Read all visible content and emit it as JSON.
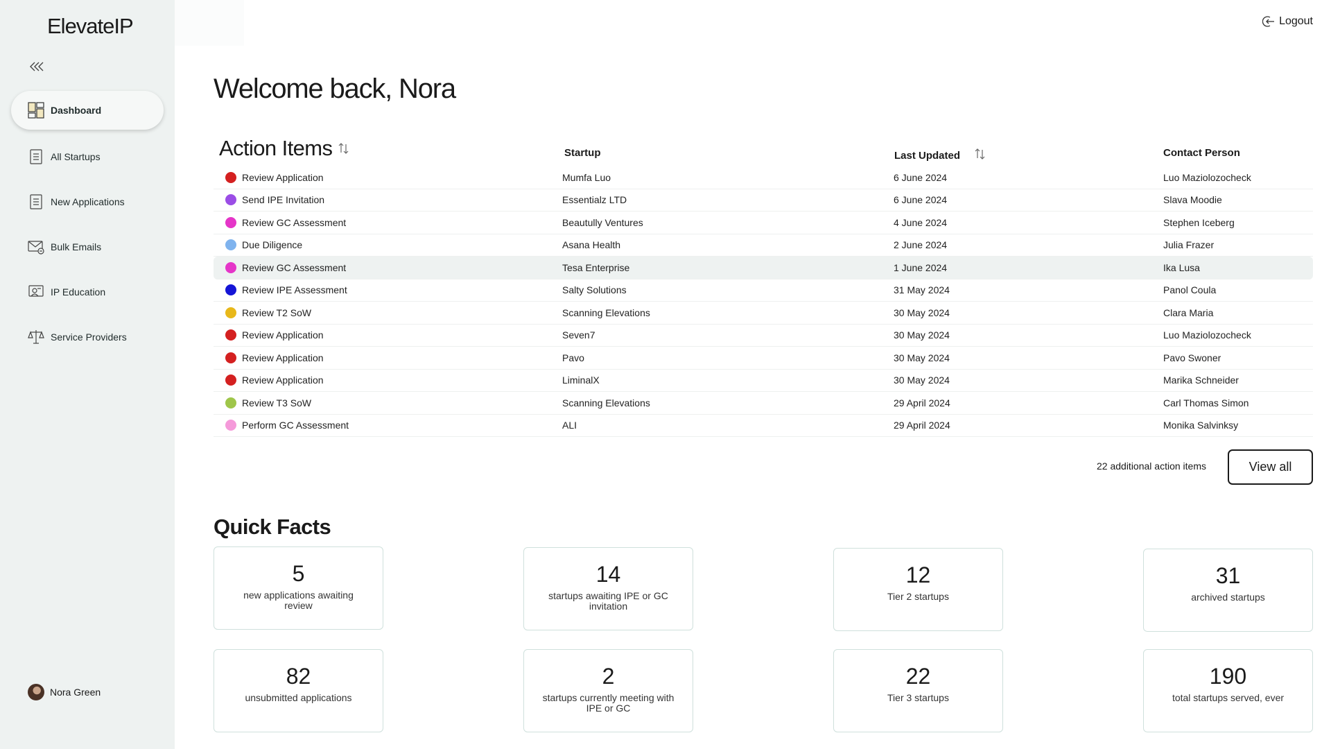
{
  "app": {
    "logo": "ElevateIP"
  },
  "sidebar": {
    "items": [
      {
        "label": "Dashboard",
        "icon": "dashboard-icon",
        "active": true
      },
      {
        "label": "All Startups",
        "icon": "document-list-icon"
      },
      {
        "label": "New Applications",
        "icon": "document-list-icon"
      },
      {
        "label": "Bulk Emails",
        "icon": "mail-icon"
      },
      {
        "label": "IP Education",
        "icon": "presentation-icon"
      },
      {
        "label": "Service Providers",
        "icon": "scales-icon"
      }
    ],
    "user": {
      "name": "Nora Green"
    }
  },
  "header": {
    "logout": "Logout"
  },
  "welcome": "Welcome back, Nora",
  "action_items": {
    "title": "Action Items",
    "columns": {
      "startup": "Startup",
      "last_updated": "Last Updated",
      "contact": "Contact Person"
    },
    "rows": [
      {
        "action": "Review Application",
        "color": "#d42020",
        "startup": "Mumfa Luo",
        "updated": "6 June 2024",
        "contact": "Luo Maziolozocheck"
      },
      {
        "action": "Send IPE Invitation",
        "color": "#9b4de6",
        "startup": "Essentialz LTD",
        "updated": "6 June 2024",
        "contact": "Slava Moodie"
      },
      {
        "action": "Review GC Assessment",
        "color": "#e535c8",
        "startup": "Beautully Ventures",
        "updated": "4 June 2024",
        "contact": "Stephen Iceberg"
      },
      {
        "action": "Due Diligence",
        "color": "#7fb3ee",
        "startup": "Asana Health",
        "updated": "2 June 2024",
        "contact": "Julia Frazer"
      },
      {
        "action": "Review GC Assessment",
        "color": "#e535c8",
        "startup": "Tesa Enterprise",
        "updated": "1 June 2024",
        "contact": "Ika Lusa",
        "highlighted": true
      },
      {
        "action": "Review IPE Assessment",
        "color": "#1515d6",
        "startup": "Salty Solutions",
        "updated": "31 May 2024",
        "contact": "Panol Coula"
      },
      {
        "action": "Review T2 SoW",
        "color": "#e8b81a",
        "startup": "Scanning Elevations",
        "updated": "30 May 2024",
        "contact": "Clara Maria"
      },
      {
        "action": "Review Application",
        "color": "#d42020",
        "startup": "Seven7",
        "updated": "30 May 2024",
        "contact": "Luo Maziolozocheck"
      },
      {
        "action": "Review Application",
        "color": "#d42020",
        "startup": "Pavo",
        "updated": "30 May 2024",
        "contact": "Pavo Swoner"
      },
      {
        "action": "Review Application",
        "color": "#d42020",
        "startup": "LiminalX",
        "updated": "30 May 2024",
        "contact": "Marika Schneider"
      },
      {
        "action": "Review T3 SoW",
        "color": "#9fc64a",
        "startup": "Scanning Elevations",
        "updated": "29 April 2024",
        "contact": "Carl Thomas Simon"
      },
      {
        "action": "Perform GC Assessment",
        "color": "#f59ada",
        "startup": "ALI",
        "updated": "29 April 2024",
        "contact": "Monika Salvinksy"
      }
    ],
    "more_text": "22 additional action items",
    "view_all": "View all"
  },
  "quick_facts": {
    "title": "Quick Facts",
    "cards": [
      {
        "value": "5",
        "label": "new applications awaiting review"
      },
      {
        "value": "14",
        "label": "startups awaiting IPE or GC invitation"
      },
      {
        "value": "12",
        "label": "Tier 2 startups"
      },
      {
        "value": "31",
        "label": "archived startups"
      },
      {
        "value": "82",
        "label": "unsubmitted applications"
      },
      {
        "value": "2",
        "label": "startups currently meeting with IPE or GC"
      },
      {
        "value": "22",
        "label": "Tier 3 startups"
      },
      {
        "value": "190",
        "label": "total startups served, ever"
      }
    ]
  },
  "colors": {
    "sidebar_bg": "#eef2f1",
    "card_border": "#cfe0dc"
  }
}
